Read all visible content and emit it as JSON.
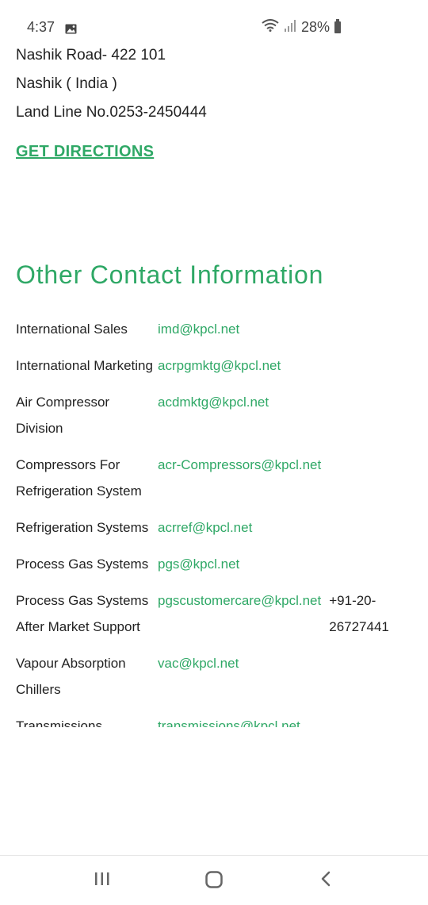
{
  "status_bar": {
    "time": "4:37",
    "battery": "28%"
  },
  "address": {
    "lines": [
      "Nashik Road- 422 101",
      "Nashik ( India )",
      "Land Line No.0253-2450444"
    ],
    "directions_label": "GET DIRECTIONS"
  },
  "section_title": "Other Contact Information",
  "contacts": [
    {
      "label": "International Sales",
      "email": "imd@kpcl.net"
    },
    {
      "label": "International Marketing",
      "email": "acrpgmktg@kpcl.net"
    },
    {
      "label": "Air Compressor Division",
      "email": "acdmktg@kpcl.net"
    },
    {
      "label": "Compressors For Refrigeration System",
      "email": "acr-Compressors@kpcl.net"
    },
    {
      "label": "Refrigeration Systems",
      "email": "acrref@kpcl.net"
    },
    {
      "label": "Process Gas Systems",
      "email": "pgs@kpcl.net"
    },
    {
      "label": "Process Gas Systems After Market Support",
      "email": "pgscustomercare@kpcl.net",
      "phone": "+91-20-26727441"
    },
    {
      "label": "Vapour Absorption Chillers",
      "email": "vac@kpcl.net"
    },
    {
      "label": "Transmissions",
      "email": "transmissions@kpcl.net"
    }
  ]
}
